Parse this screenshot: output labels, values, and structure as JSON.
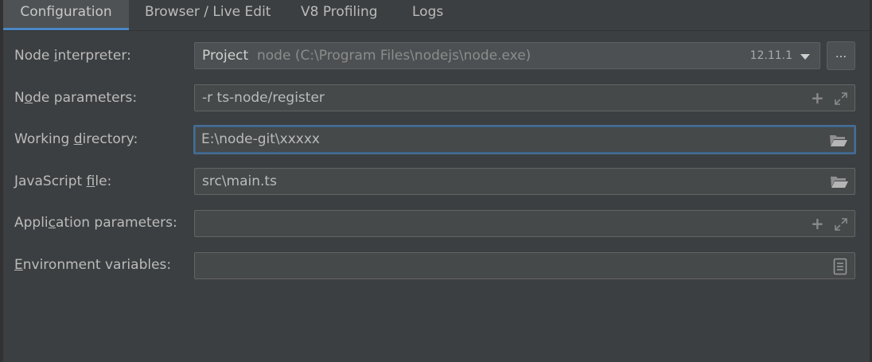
{
  "tabs": [
    {
      "label": "Configuration",
      "active": true
    },
    {
      "label": "Browser / Live Edit",
      "active": false
    },
    {
      "label": "V8 Profiling",
      "active": false
    },
    {
      "label": "Logs",
      "active": false
    }
  ],
  "form": {
    "node_interpreter": {
      "label_parts": [
        "Node ",
        "i",
        "nterpreter:"
      ],
      "project": "Project",
      "path": "node (C:\\Program Files\\nodejs\\node.exe)",
      "version": "12.11.1",
      "browse_label": "..."
    },
    "node_parameters": {
      "label_parts": [
        "N",
        "o",
        "de parameters:"
      ],
      "value": "-r ts-node/register",
      "icons": [
        "plus-icon",
        "expand-icon"
      ]
    },
    "working_directory": {
      "label_parts": [
        "Working ",
        "d",
        "irectory:"
      ],
      "value": "E:\\node-git\\xxxxx",
      "icon": "folder-icon"
    },
    "javascript_file": {
      "label_parts": [
        "JavaScript ",
        "f",
        "ile:"
      ],
      "value": "src\\main.ts",
      "icon": "folder-icon"
    },
    "application_parameters": {
      "label_parts": [
        "Appli",
        "c",
        "ation parameters:"
      ],
      "value": "",
      "icons": [
        "plus-icon",
        "expand-icon"
      ]
    },
    "environment_variables": {
      "label_parts": [
        "",
        "E",
        "nvironment variables:"
      ],
      "value": "",
      "icon": "document-icon"
    }
  },
  "colors": {
    "background": "#3c3f41",
    "field_bg": "#45494a",
    "accent_tab_underline": "#4a88c7",
    "focus_border": "#466d94",
    "text": "#bbbbbb"
  }
}
